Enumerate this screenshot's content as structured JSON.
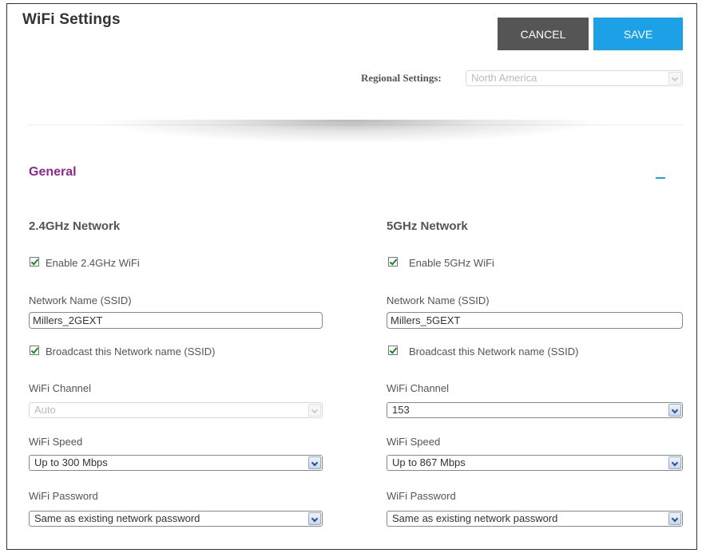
{
  "page": {
    "title": "WiFi Settings"
  },
  "actions": {
    "cancel_label": "CANCEL",
    "save_label": "SAVE"
  },
  "regional": {
    "label": "Regional Settings:",
    "value": "North America"
  },
  "general": {
    "title": "General",
    "collapse_icon": "minus-icon"
  },
  "network_24": {
    "title": "2.4GHz Network",
    "enable_label": "Enable 2.4GHz WiFi",
    "ssid_label": "Network Name (SSID)",
    "ssid_value": "Millers_2GEXT",
    "broadcast_label": "Broadcast this Network name (SSID)",
    "channel_label": "WiFi Channel",
    "channel_value": "Auto",
    "speed_label": "WiFi Speed",
    "speed_value": "Up to 300 Mbps",
    "password_label": "WiFi Password",
    "password_value": "Same as existing network password"
  },
  "network_5": {
    "title": "5GHz Network",
    "enable_label": "Enable 5GHz WiFi",
    "ssid_label": "Network Name (SSID)",
    "ssid_value": "Millers_5GEXT",
    "broadcast_label": "Broadcast this Network name (SSID)",
    "channel_label": "WiFi Channel",
    "channel_value": "153",
    "speed_label": "WiFi Speed",
    "speed_value": "Up to 867 Mbps",
    "password_label": "WiFi Password",
    "password_value": "Same as existing network password"
  },
  "colors": {
    "accent": "#1da1e6",
    "cancel": "#555555",
    "section": "#8b2a8b",
    "check": "#1a8a1a"
  }
}
